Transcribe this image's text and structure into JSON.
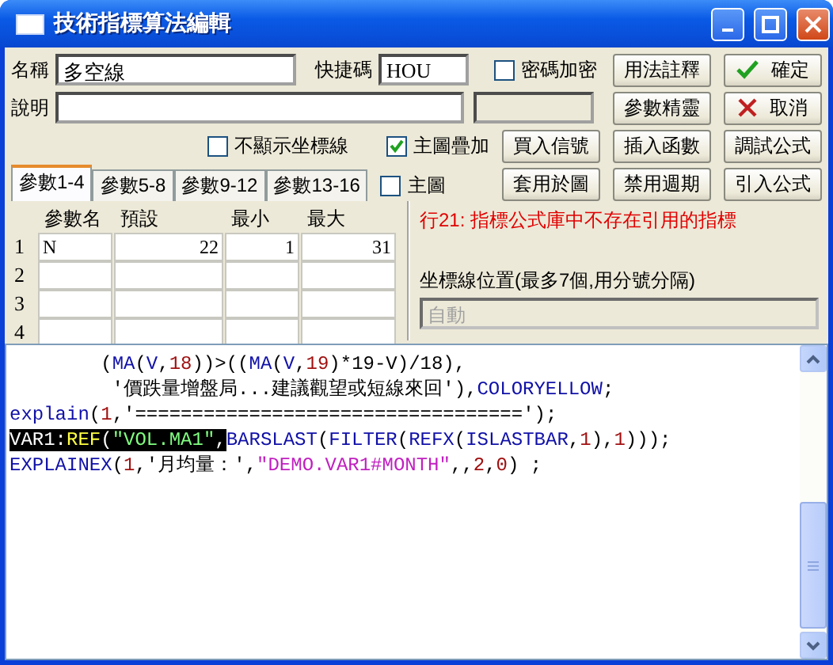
{
  "window": {
    "title": "技術指標算法編輯"
  },
  "form": {
    "name_label": "名稱",
    "name_value": "多空線",
    "hotkey_label": "快捷碼",
    "hotkey_value": "HOU",
    "description_label": "說明"
  },
  "password_checkbox": {
    "label": "密碼加密",
    "checked": false
  },
  "hide_axis_checkbox": {
    "label": "不顯示坐標線",
    "checked": false
  },
  "overlay_checkbox": {
    "label": "主圖疊加",
    "checked": true
  },
  "main_chart_checkbox": {
    "label": "主圖",
    "checked": false
  },
  "button_rows": [
    [
      {
        "label": "用法註釋",
        "kind": "plain"
      },
      {
        "label": "確定",
        "kind": "ok"
      }
    ],
    [
      {
        "label": "參數精靈",
        "kind": "plain"
      },
      {
        "label": "取消",
        "kind": "cancel"
      }
    ],
    [
      {
        "label": "買入信號",
        "kind": "plain"
      },
      {
        "label": "插入函數",
        "kind": "plain"
      },
      {
        "label": "調試公式",
        "kind": "plain"
      }
    ],
    [
      {
        "label": "套用於圖",
        "kind": "plain"
      },
      {
        "label": "禁用週期",
        "kind": "plain"
      },
      {
        "label": "引入公式",
        "kind": "plain"
      }
    ]
  ],
  "tabs": [
    {
      "label": "參數1-4",
      "selected": true
    },
    {
      "label": "參數5-8",
      "selected": false
    },
    {
      "label": "參數9-12",
      "selected": false
    },
    {
      "label": "參數13-16",
      "selected": false
    }
  ],
  "param_table": {
    "columns": [
      "參數名",
      "預設",
      "最小",
      "最大"
    ],
    "rows": [
      {
        "index": "1",
        "name": "N",
        "default": "22",
        "min": "1",
        "max": "31"
      },
      {
        "index": "2"
      },
      {
        "index": "3"
      },
      {
        "index": "4"
      }
    ]
  },
  "error_message": "行21: 指標公式庫中不存在引用的指標",
  "axis_position": {
    "label": "坐標線位置(最多7個,用分號分隔)",
    "value": "自動",
    "disabled": true
  },
  "code_lines": [
    [
      {
        "text": "        (",
        "kind": "plain",
        "selected": false
      },
      {
        "text": "MA",
        "kind": "func",
        "selected": false
      },
      {
        "text": "(",
        "kind": "plain",
        "selected": false
      },
      {
        "text": "V",
        "kind": "func",
        "selected": false
      },
      {
        "text": ",",
        "kind": "plain",
        "selected": false
      },
      {
        "text": "18",
        "kind": "num",
        "selected": false
      },
      {
        "text": "))>((",
        "kind": "plain",
        "selected": false
      },
      {
        "text": "MA",
        "kind": "func",
        "selected": false
      },
      {
        "text": "(",
        "kind": "plain",
        "selected": false
      },
      {
        "text": "V",
        "kind": "func",
        "selected": false
      },
      {
        "text": ",",
        "kind": "plain",
        "selected": false
      },
      {
        "text": "19",
        "kind": "num",
        "selected": false
      },
      {
        "text": ")*19-V)/18),",
        "kind": "plain",
        "selected": false
      }
    ],
    [
      {
        "text": "         '價跌量增盤局...建議觀望或短線來回'),",
        "kind": "plain",
        "selected": false
      },
      {
        "text": "COLORYELLOW",
        "kind": "func",
        "selected": false
      },
      {
        "text": ";",
        "kind": "plain",
        "selected": false
      }
    ],
    [
      {
        "text": "explain",
        "kind": "func",
        "selected": false
      },
      {
        "text": "(",
        "kind": "plain",
        "selected": false
      },
      {
        "text": "1",
        "kind": "num",
        "selected": false
      },
      {
        "text": ",'==================================');",
        "kind": "plain",
        "selected": false
      }
    ],
    [
      {
        "text": "VAR1:",
        "kind": "plain",
        "selected": true
      },
      {
        "text": "REF",
        "kind": "func",
        "selected": true
      },
      {
        "text": "(",
        "kind": "plain",
        "selected": true
      },
      {
        "text": "\"VOL.MA1\"",
        "kind": "str",
        "selected": true
      },
      {
        "text": ",",
        "kind": "plain",
        "selected": true
      },
      {
        "text": "BARSLAST",
        "kind": "func",
        "selected": false
      },
      {
        "text": "(",
        "kind": "plain",
        "selected": false
      },
      {
        "text": "FILTER",
        "kind": "func",
        "selected": false
      },
      {
        "text": "(",
        "kind": "plain",
        "selected": false
      },
      {
        "text": "REFX",
        "kind": "func",
        "selected": false
      },
      {
        "text": "(",
        "kind": "plain",
        "selected": false
      },
      {
        "text": "ISLASTBAR",
        "kind": "func",
        "selected": false
      },
      {
        "text": ",",
        "kind": "plain",
        "selected": false
      },
      {
        "text": "1",
        "kind": "num",
        "selected": false
      },
      {
        "text": "),",
        "kind": "plain",
        "selected": false
      },
      {
        "text": "1",
        "kind": "num",
        "selected": false
      },
      {
        "text": ")));",
        "kind": "plain",
        "selected": false
      }
    ],
    [
      {
        "text": "EXPLAINEX",
        "kind": "func",
        "selected": false
      },
      {
        "text": "(",
        "kind": "plain",
        "selected": false
      },
      {
        "text": "1",
        "kind": "num",
        "selected": false
      },
      {
        "text": ",'月均量：',",
        "kind": "plain",
        "selected": false
      },
      {
        "text": "\"DEMO.VAR1#MONTH\"",
        "kind": "str",
        "selected": false
      },
      {
        "text": ",,",
        "kind": "plain",
        "selected": false
      },
      {
        "text": "2",
        "kind": "num",
        "selected": false
      },
      {
        "text": ",",
        "kind": "plain",
        "selected": false
      },
      {
        "text": "0",
        "kind": "num",
        "selected": false
      },
      {
        "text": ") ;",
        "kind": "plain",
        "selected": false
      }
    ]
  ]
}
